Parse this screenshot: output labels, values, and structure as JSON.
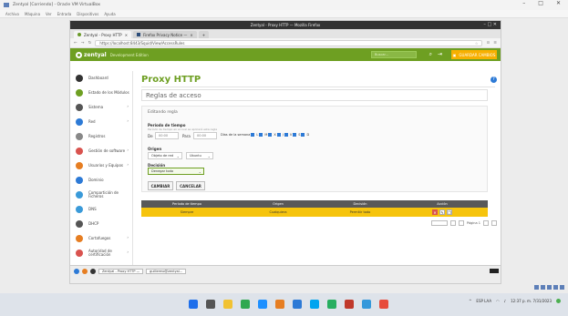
{
  "host": {
    "title": "Zentyal [Corriendo] - Oracle VM VirtualBox",
    "menu": [
      "Archivo",
      "Máquina",
      "Ver",
      "Entrada",
      "Dispositivos",
      "Ayuda"
    ]
  },
  "guest_window": {
    "title": "Zentyal - Proxy HTTP — Mozilla Firefox",
    "tabs": [
      {
        "label": "Zentyal - Proxy HTTP"
      },
      {
        "label": "Firefox Privacy Notice —"
      }
    ],
    "url": "https://localhost:8443/Squid/View/AccessRules"
  },
  "zentyal": {
    "logo": "zentyal",
    "edition": "Development Edition",
    "search_placeholder": "Buscar...",
    "user": "GUARDAR CAMBIOS"
  },
  "sidebar": {
    "items": [
      {
        "label": "Dashboard",
        "color": "#333333"
      },
      {
        "label": "Estado de los Módulos",
        "color": "#6e9f22"
      },
      {
        "label": "Sistema",
        "color": "#555555"
      },
      {
        "label": "Red",
        "color": "#2d7ad6"
      },
      {
        "label": "Registros",
        "color": "#888888"
      },
      {
        "label": "Gestión de software",
        "color": "#d9534f"
      },
      {
        "label": "Usuarios y Equipos",
        "color": "#e67e22"
      },
      {
        "label": "Dominio",
        "color": "#2d7ad6"
      },
      {
        "label": "Compartición de Ficheros",
        "color": "#3a9ad9"
      },
      {
        "label": "DNS",
        "color": "#3a9ad9"
      },
      {
        "label": "DHCP",
        "color": "#555555"
      },
      {
        "label": "Cortafuegos",
        "color": "#e67e22"
      },
      {
        "label": "Autoridad de certificación",
        "color": "#d9534f"
      }
    ]
  },
  "main": {
    "page_title": "Proxy HTTP",
    "subtitle": "Reglas de acceso",
    "form": {
      "title": "Editando regla",
      "period_label": "Período de tiempo",
      "period_hint": "Período de tiempo en el cual se aplicará esta regla",
      "from_label": "De",
      "from_placeholder": "00:00",
      "to_label": "Para",
      "to_placeholder": "00:00",
      "days_label": "Días de la semana",
      "days": [
        "L",
        "M",
        "X",
        "J",
        "V",
        "S",
        "D"
      ],
      "source_label": "Origen",
      "source_value": "Objeto de red",
      "source_object": "Ubuntu",
      "decision_label": "Decisión",
      "decision_value": "Denegar todo",
      "change_button": "CAMBIAR",
      "cancel_button": "CANCELAR"
    },
    "table": {
      "headers": [
        "Período de tiempo",
        "Origen",
        "Decisión",
        "Acción"
      ],
      "rows": [
        {
          "period": "Siempre",
          "source": "Cualquiera",
          "decision": "Permitir todo"
        }
      ]
    },
    "pager": {
      "page_text": "Página 1"
    }
  },
  "guest_taskbar": {
    "items": [
      "Zentyal - Proxy HTTP —",
      "guillermo@zentyal..."
    ]
  },
  "host_taskbar": {
    "time": "12:37 p. m.",
    "date": "7/31/2023",
    "lang": "ESP LAA"
  }
}
